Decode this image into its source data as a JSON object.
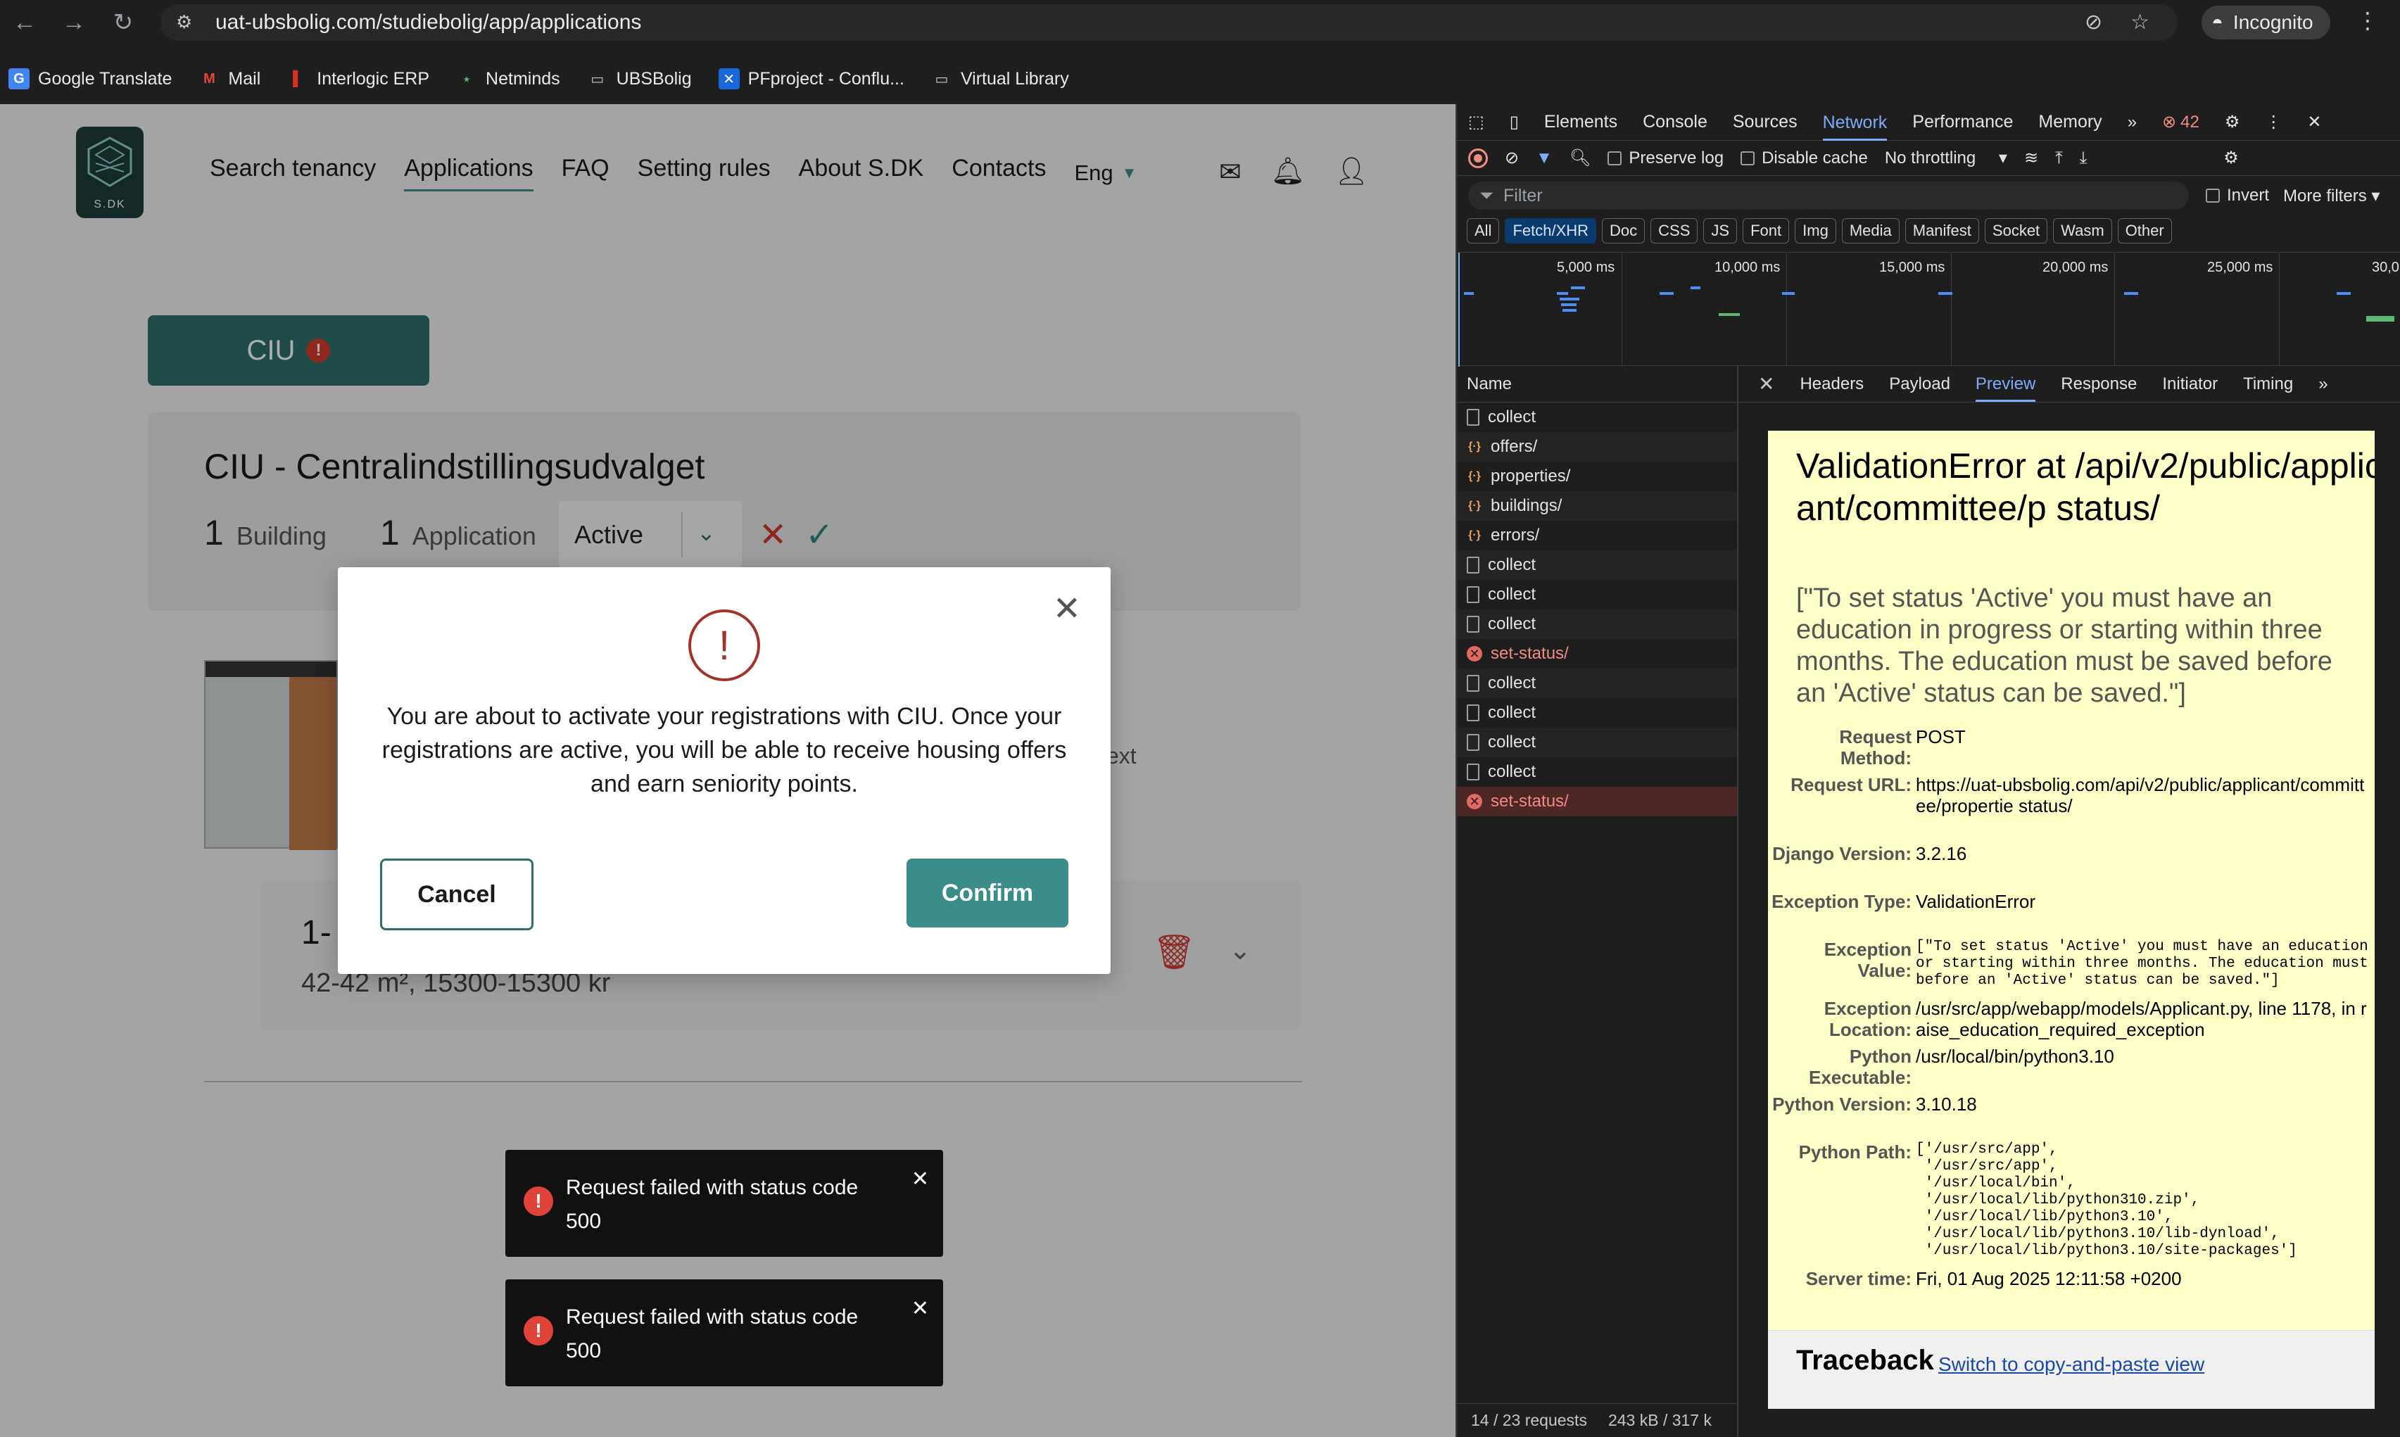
{
  "browser": {
    "url": "uat-ubsbolig.com/studiebolig/app/applications",
    "incognito_label": "Incognito",
    "bookmarks": [
      {
        "label": "Google Translate",
        "icon": "google-translate-icon"
      },
      {
        "label": "Mail",
        "icon": "gmail-icon"
      },
      {
        "label": "Interlogic ERP",
        "icon": "interlogic-icon"
      },
      {
        "label": "Netminds",
        "icon": "netminds-icon"
      },
      {
        "label": "UBSBolig",
        "icon": "folder-icon"
      },
      {
        "label": "PFproject - Conflu...",
        "icon": "confluence-icon"
      },
      {
        "label": "Virtual Library",
        "icon": "folder-icon"
      }
    ]
  },
  "site": {
    "logo_text": "S.DK",
    "nav": [
      "Search tenancy",
      "Applications",
      "FAQ",
      "Setting rules",
      "About S.DK",
      "Contacts"
    ],
    "active_nav": "Applications",
    "language": "Eng",
    "ciu_button": "CIU",
    "committee_title": "CIU - Centralindstillingsudvalget",
    "buildings_count": "1",
    "buildings_label": "Building",
    "applications_count": "1",
    "applications_label": "Application",
    "status_value": "Active",
    "partial_text": "ext",
    "card_title": "1-",
    "card_sub": "42-42 m², 15300-15300 kr"
  },
  "modal": {
    "text": "You are about to activate your registrations with CIU. Once your registrations are active, you will be able to receive housing offers and earn seniority points.",
    "cancel": "Cancel",
    "confirm": "Confirm"
  },
  "toasts": [
    {
      "text": "Request failed with status code 500"
    },
    {
      "text": "Request failed with status code 500"
    }
  ],
  "devtools": {
    "tabs": [
      "Elements",
      "Console",
      "Sources",
      "Network",
      "Performance",
      "Memory"
    ],
    "selected_tab": "Network",
    "error_count": "42",
    "preserve_log": "Preserve log",
    "disable_cache": "Disable cache",
    "throttling": "No throttling",
    "filter_placeholder": "Filter",
    "invert": "Invert",
    "more_filters": "More filters",
    "types": [
      "All",
      "Fetch/XHR",
      "Doc",
      "CSS",
      "JS",
      "Font",
      "Img",
      "Media",
      "Manifest",
      "Socket",
      "Wasm",
      "Other"
    ],
    "selected_type": "Fetch/XHR",
    "timeline_labels": [
      "5,000 ms",
      "10,000 ms",
      "15,000 ms",
      "20,000 ms",
      "25,000 ms",
      "30,0"
    ],
    "name_header": "Name",
    "requests": [
      {
        "name": "collect",
        "kind": "doc"
      },
      {
        "name": "offers/",
        "kind": "xhr"
      },
      {
        "name": "properties/",
        "kind": "xhr"
      },
      {
        "name": "buildings/",
        "kind": "xhr"
      },
      {
        "name": "errors/",
        "kind": "xhr"
      },
      {
        "name": "collect",
        "kind": "doc"
      },
      {
        "name": "collect",
        "kind": "doc"
      },
      {
        "name": "collect",
        "kind": "doc"
      },
      {
        "name": "set-status/",
        "kind": "error"
      },
      {
        "name": "collect",
        "kind": "doc"
      },
      {
        "name": "collect",
        "kind": "doc"
      },
      {
        "name": "collect",
        "kind": "doc"
      },
      {
        "name": "collect",
        "kind": "doc"
      },
      {
        "name": "set-status/",
        "kind": "error-selected"
      }
    ],
    "footer_requests": "14 / 23 requests",
    "footer_size": "243 kB / 317 k",
    "detail_tabs": [
      "Headers",
      "Payload",
      "Preview",
      "Response",
      "Initiator",
      "Timing"
    ],
    "selected_detail_tab": "Preview"
  },
  "preview": {
    "title": "ValidationError at /api/v2/public/applicant/committee/p status/",
    "message": "[\"To set status 'Active' you must have an education in progress or starting within three months. The education must be saved before an 'Active' status can be saved.\"]",
    "rows": [
      {
        "key": "Request Method:",
        "value": "POST"
      },
      {
        "key": "Request URL:",
        "value": "https://uat-ubsbolig.com/api/v2/public/applicant/committee/propertie status/"
      },
      {
        "key": "Django Version:",
        "value": "3.2.16"
      },
      {
        "key": "Exception Type:",
        "value": "ValidationError"
      },
      {
        "key": "Exception Value:",
        "value": "[\"To set status 'Active' you must have an education\nor starting within three months. The education must\nbefore an 'Active' status can be saved.\"]"
      },
      {
        "key": "Exception Location:",
        "value": "/usr/src/app/webapp/models/Applicant.py, line 1178, in raise_education_required_exception"
      },
      {
        "key": "Python Executable:",
        "value": "/usr/local/bin/python3.10"
      },
      {
        "key": "Python Version:",
        "value": "3.10.18"
      },
      {
        "key": "Python Path:",
        "value": "['/usr/src/app',\n '/usr/src/app',\n '/usr/local/bin',\n '/usr/local/lib/python310.zip',\n '/usr/local/lib/python3.10',\n '/usr/local/lib/python3.10/lib-dynload',\n '/usr/local/lib/python3.10/site-packages']"
      },
      {
        "key": "Server time:",
        "value": "Fri, 01 Aug 2025 12:11:58 +0200"
      }
    ],
    "traceback_title": "Traceback",
    "traceback_link": "Switch to copy-and-paste view"
  }
}
